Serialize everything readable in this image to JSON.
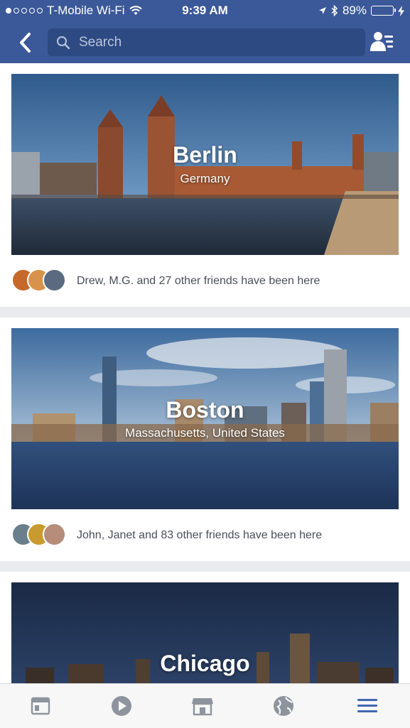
{
  "status_bar": {
    "carrier": "T-Mobile Wi-Fi",
    "time": "9:39 AM",
    "battery": "89%",
    "battery_level": 0.89
  },
  "header": {
    "search_placeholder": "Search"
  },
  "cards": [
    {
      "title": "Berlin",
      "subtitle": "Germany",
      "friends_text": "Drew, M.G. and 27 other friends have been here"
    },
    {
      "title": "Boston",
      "subtitle": "Massachusetts, United States",
      "friends_text": "John, Janet and 83 other friends have been here"
    },
    {
      "title": "Chicago"
    }
  ],
  "colors": {
    "brand": "#3b5998",
    "tab_active": "#4267b2",
    "tab_inactive": "#8d949e"
  },
  "tab_bar": {
    "tabs": [
      "news-feed-icon",
      "video-icon",
      "marketplace-icon",
      "globe-icon",
      "menu-icon"
    ],
    "active": "menu-icon"
  }
}
